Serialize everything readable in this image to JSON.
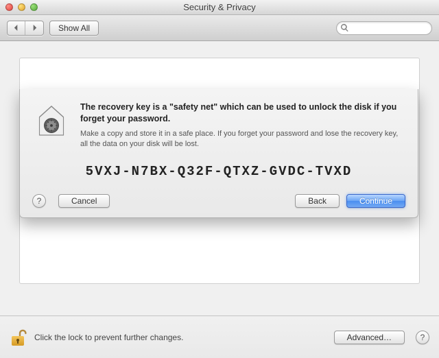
{
  "window": {
    "title": "Security & Privacy"
  },
  "toolbar": {
    "show_all": "Show All",
    "search_placeholder": ""
  },
  "sheet": {
    "heading": "The recovery key is a \"safety net\" which can be used to unlock the disk if you forget your password.",
    "subtext": "Make a copy and store it in a safe place. If you forget your password and lose the recovery key, all the data on your disk will be lost.",
    "recovery_key": "5VXJ-N7BX-Q32F-QTXZ-GVDC-TVXD",
    "help": "?",
    "cancel": "Cancel",
    "back": "Back",
    "continue": "Continue"
  },
  "footer": {
    "lock_msg": "Click the lock to prevent further changes.",
    "advanced": "Advanced…",
    "help": "?"
  }
}
